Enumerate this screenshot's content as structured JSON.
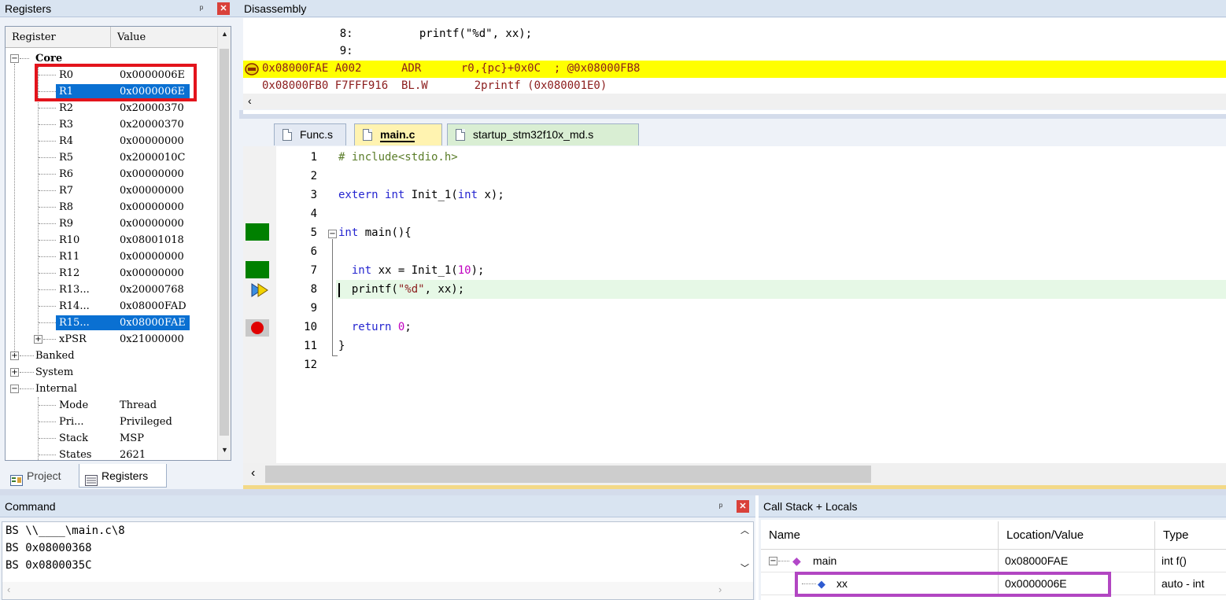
{
  "registers": {
    "title": "Registers",
    "col_register": "Register",
    "col_value": "Value",
    "groups": {
      "core": "Core",
      "banked": "Banked",
      "system": "System",
      "internal": "Internal"
    },
    "core_rows": [
      {
        "name": "R0",
        "value": "0x0000006E"
      },
      {
        "name": "R1",
        "value": "0x0000006E"
      },
      {
        "name": "R2",
        "value": "0x20000370"
      },
      {
        "name": "R3",
        "value": "0x20000370"
      },
      {
        "name": "R4",
        "value": "0x00000000"
      },
      {
        "name": "R5",
        "value": "0x2000010C"
      },
      {
        "name": "R6",
        "value": "0x00000000"
      },
      {
        "name": "R7",
        "value": "0x00000000"
      },
      {
        "name": "R8",
        "value": "0x00000000"
      },
      {
        "name": "R9",
        "value": "0x00000000"
      },
      {
        "name": "R10",
        "value": "0x08001018"
      },
      {
        "name": "R11",
        "value": "0x00000000"
      },
      {
        "name": "R12",
        "value": "0x00000000"
      },
      {
        "name": "R13...",
        "value": "0x20000768"
      },
      {
        "name": "R14...",
        "value": "0x08000FAD"
      },
      {
        "name": "R15...",
        "value": "0x08000FAE"
      }
    ],
    "xpsr": {
      "name": "xPSR",
      "value": "0x21000000"
    },
    "internal_rows": [
      {
        "name": "Mode",
        "value": "Thread"
      },
      {
        "name": "Pri...",
        "value": "Privileged"
      },
      {
        "name": "Stack",
        "value": "MSP"
      },
      {
        "name": "States",
        "value": "2621"
      }
    ],
    "tabs": {
      "project": "Project",
      "registers": "Registers"
    }
  },
  "disassembly": {
    "title": "Disassembly",
    "lines": [
      {
        "text": "    8:          printf(\"%d\", xx);"
      },
      {
        "text": "    9:"
      },
      {
        "text": "0x08000FAE A002      ADR      r0,{pc}+0x0C  ; @0x08000FB8"
      },
      {
        "text": "0x08000FB0 F7FFF916  BL.W       2printf (0x080001E0)"
      }
    ]
  },
  "editor": {
    "tabs": [
      "Func.s",
      "main.c",
      "startup_stm32f10x_md.s"
    ],
    "active_tab": "main.c",
    "lines": [
      {
        "n": "1",
        "text": "# include<stdio.h>"
      },
      {
        "n": "2",
        "text": ""
      },
      {
        "n": "3",
        "text": "extern int Init_1(int x);"
      },
      {
        "n": "4",
        "text": ""
      },
      {
        "n": "5",
        "text": "int main(){"
      },
      {
        "n": "6",
        "text": ""
      },
      {
        "n": "7",
        "text": "  int xx = Init_1(10);"
      },
      {
        "n": "8",
        "text": "  printf(\"%d\", xx);"
      },
      {
        "n": "9",
        "text": ""
      },
      {
        "n": "10",
        "text": "  return 0;"
      },
      {
        "n": "11",
        "text": "}"
      },
      {
        "n": "12",
        "text": ""
      }
    ]
  },
  "command": {
    "title": "Command",
    "lines": [
      "BS \\\\____\\main.c\\8",
      "BS 0x08000368",
      "BS 0x0800035C"
    ]
  },
  "callstack": {
    "title": "Call Stack + Locals",
    "col_name": "Name",
    "col_location": "Location/Value",
    "col_type": "Type",
    "rows": [
      {
        "name": "main",
        "location": "0x08000FAE",
        "type": "int f()"
      },
      {
        "name": "xx",
        "location": "0x0000006E",
        "type": "auto - int"
      }
    ]
  },
  "colors": {
    "current_line": "#ffff00",
    "exec_line_bg": "#e6f8e6",
    "selection": "#0a70d2",
    "highlight_red": "#e3141c",
    "highlight_purple": "#b246c2"
  }
}
